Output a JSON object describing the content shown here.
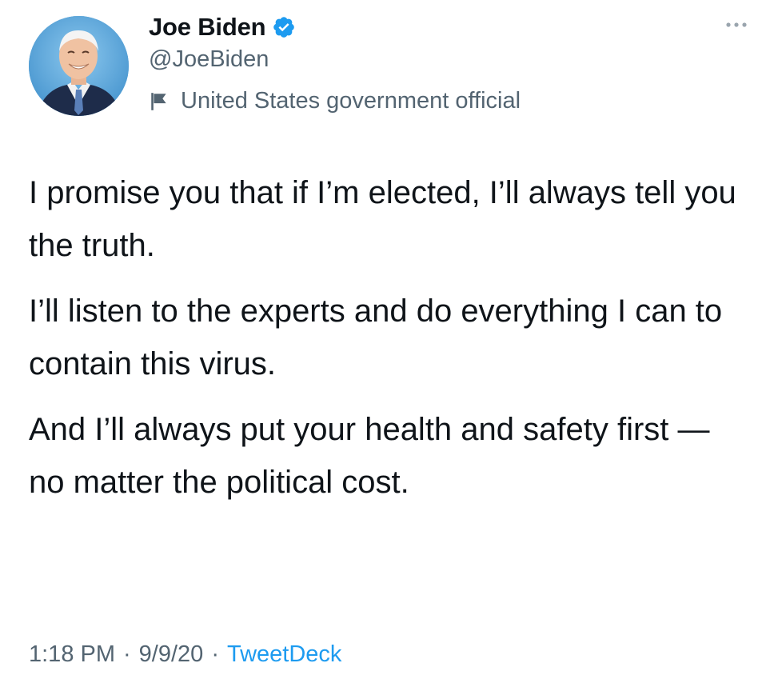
{
  "author": {
    "display_name": "Joe Biden",
    "handle": "@JoeBiden",
    "verified": true,
    "label": "United States government official"
  },
  "tweet": {
    "paragraphs": [
      "I promise you that if I’m elected, I’ll always tell you the truth.",
      "I’ll listen to the experts and do everything I can to contain this virus.",
      "And I’ll always put your health and safety first — no matter the political cost."
    ],
    "time": "1:18 PM",
    "date": "9/9/20",
    "source": "TweetDeck",
    "separator": "·"
  },
  "colors": {
    "text": "#0f1419",
    "secondary": "#536471",
    "accent": "#1d9bf0"
  },
  "icons": {
    "verified": "verified-badge-icon",
    "label": "government-flag-icon",
    "more": "more-dots-icon"
  }
}
